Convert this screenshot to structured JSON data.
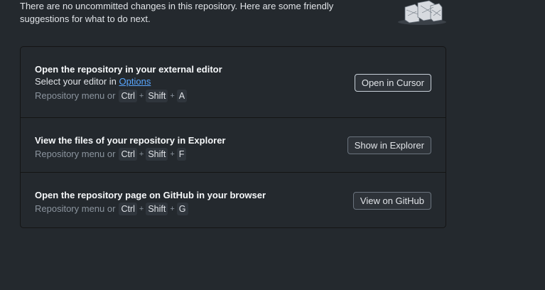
{
  "intro": {
    "text": "There are no uncommitted changes in this repository. Here are some friendly suggestions for what to do next."
  },
  "illustration": {
    "icon": "boxes-illustration-icon"
  },
  "suggestions": [
    {
      "title": "Open the repository in your external editor",
      "description_prefix": "Select your editor in ",
      "description_link": "Options",
      "shortcut_prefix": "Repository menu or",
      "keys": [
        "Ctrl",
        "Shift",
        "A"
      ],
      "button": "Open in Cursor"
    },
    {
      "title": "View the files of your repository in Explorer",
      "shortcut_prefix": "Repository menu or",
      "keys": [
        "Ctrl",
        "Shift",
        "F"
      ],
      "button": "Show in Explorer"
    },
    {
      "title": "Open the repository page on GitHub in your browser",
      "shortcut_prefix": "Repository menu or",
      "keys": [
        "Ctrl",
        "Shift",
        "G"
      ],
      "button": "View on GitHub"
    }
  ],
  "plus_sign": "+",
  "colors": {
    "background": "#24292e",
    "link": "#58a6ff",
    "muted": "#8b949e"
  }
}
